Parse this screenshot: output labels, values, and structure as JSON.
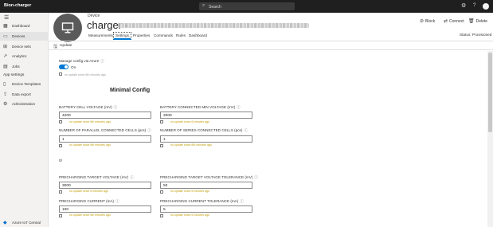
{
  "topbar": {
    "app_name": "Bion-charger",
    "search_placeholder": "Search"
  },
  "sidebar": {
    "items": [
      {
        "label": "Dashboard",
        "icon": "dashboard-icon"
      },
      {
        "label": "Devices",
        "icon": "devices-icon"
      },
      {
        "label": "Device sets",
        "icon": "device-sets-icon"
      },
      {
        "label": "Analytics",
        "icon": "analytics-icon"
      },
      {
        "label": "Jobs",
        "icon": "jobs-icon"
      }
    ],
    "section_heading": "App settings",
    "settings_items": [
      {
        "label": "Device Templates",
        "icon": "device-templates-icon"
      },
      {
        "label": "Data export",
        "icon": "data-export-icon"
      },
      {
        "label": "Administration",
        "icon": "administration-icon"
      }
    ],
    "footer_label": "Azure IoT Central"
  },
  "header": {
    "device_type": "Device",
    "device_name": "charger -",
    "tabs": [
      "Measurements",
      "Settings",
      "Properties",
      "Commands",
      "Rules",
      "Dashboard"
    ],
    "active_tab": "Settings",
    "actions": {
      "block": "Block",
      "connect": "Connect",
      "delete": "Delete"
    },
    "status": "Status: Provisioned"
  },
  "toolbar": {
    "update_label": "Update"
  },
  "settings": {
    "manage_config_label": "Manage config via Azure",
    "toggle_state": "On",
    "toggle_note": "no update since 6th minutes ago",
    "section_title": "Minimal Config",
    "fields": [
      {
        "label": "BATTERY CELL VOLTAGE (mV)",
        "value": "4200",
        "note": "no update since 6th minutes ago"
      },
      {
        "label": "BATTERY CONNECTED MIN VOLTAGE (mV)",
        "value": "2000",
        "note": "no update since 6 minutes ago"
      },
      {
        "label": "NUMBER OF PARALLEL CONNECTED CELLS (pcs)",
        "value": "1",
        "note": "no update since 6th minutes ago"
      },
      {
        "label": "NUMBER OF SERIES CONNECTED CELLS (pcs)",
        "value": "1",
        "note": "no update since 6th minutes ago"
      },
      {
        "label": "PRECHARGING TARGET VOLTAGE (mV)",
        "value": "3000",
        "note": "no update since 6 minutes ago"
      },
      {
        "label": "PRECHARGING TARGET VOLTAGE TOLERANCE (mV)",
        "value": "50",
        "note": "no update since 6 minutes ago"
      },
      {
        "label": "PRECHARGING CURRENT (mA)",
        "value": "100",
        "note": "no update since 6th minutes ago"
      },
      {
        "label": "PRECHARGING CURRENT TOLERANCE (mA)",
        "value": "5",
        "note": "no update since 6 minutes ago"
      }
    ],
    "stray_text": "0/"
  }
}
